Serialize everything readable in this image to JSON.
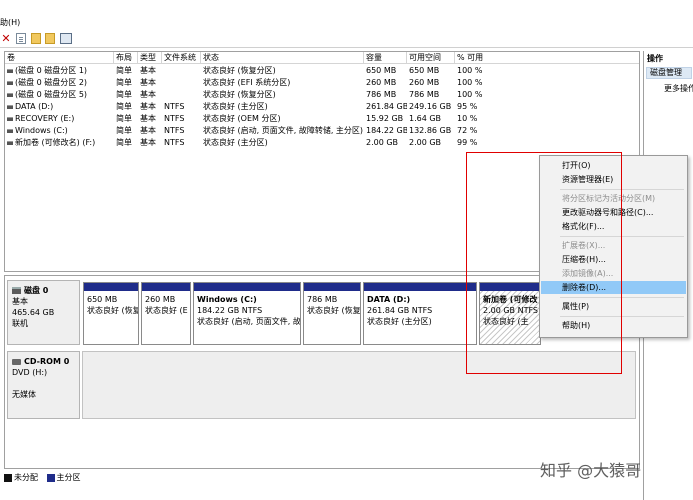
{
  "menu": {
    "help_label": "助(H)"
  },
  "toolbar": {
    "icons": [
      "delete-icon",
      "properties-icon",
      "folder-icon",
      "folder-icon",
      "panel-icon"
    ]
  },
  "volume_list": {
    "headers": [
      "卷",
      "布局",
      "类型",
      "文件系统",
      "状态",
      "容量",
      "可用空间",
      "% 可用"
    ],
    "rows": [
      [
        "(磁盘 0 磁盘分区 1)",
        "简单",
        "基本",
        "",
        "状态良好 (恢复分区)",
        "650 MB",
        "650 MB",
        "100 %"
      ],
      [
        "(磁盘 0 磁盘分区 2)",
        "简单",
        "基本",
        "",
        "状态良好 (EFI 系统分区)",
        "260 MB",
        "260 MB",
        "100 %"
      ],
      [
        "(磁盘 0 磁盘分区 5)",
        "简单",
        "基本",
        "",
        "状态良好 (恢复分区)",
        "786 MB",
        "786 MB",
        "100 %"
      ],
      [
        "DATA (D:)",
        "简单",
        "基本",
        "NTFS",
        "状态良好 (主分区)",
        "261.84 GB",
        "249.16 GB",
        "95 %"
      ],
      [
        "RECOVERY (E:)",
        "简单",
        "基本",
        "NTFS",
        "状态良好 (OEM 分区)",
        "15.92 GB",
        "1.64 GB",
        "10 %"
      ],
      [
        "Windows (C:)",
        "简单",
        "基本",
        "NTFS",
        "状态良好 (启动, 页面文件, 故障转储, 主分区)",
        "184.22 GB",
        "132.86 GB",
        "72 %"
      ],
      [
        "新加卷 (可修改名)  (F:)",
        "简单",
        "基本",
        "NTFS",
        "状态良好 (主分区)",
        "2.00 GB",
        "2.00 GB",
        "99 %"
      ]
    ]
  },
  "disk0": {
    "name": "磁盘 0",
    "type": "基本",
    "size": "465.64 GB",
    "status": "联机",
    "partitions": [
      {
        "name": "",
        "size": "650 MB",
        "status": "状态良好 (恢复"
      },
      {
        "name": "",
        "size": "260 MB",
        "status": "状态良好 (E"
      },
      {
        "name": "Windows  (C:)",
        "size": "184.22 GB NTFS",
        "status": "状态良好 (启动, 页面文件, 故"
      },
      {
        "name": "",
        "size": "786 MB",
        "status": "状态良好 (恢复"
      },
      {
        "name": "DATA  (D:)",
        "size": "261.84 GB NTFS",
        "status": "状态良好 (主分区)"
      },
      {
        "name": "新加卷 (可修改",
        "size": "2.00 GB NTFS",
        "status": "状态良好 (主"
      }
    ]
  },
  "cdrom0": {
    "name": "CD-ROM 0",
    "type": "DVD (H:)",
    "status": "无媒体"
  },
  "legend": [
    {
      "label": "未分配",
      "color": "#111111"
    },
    {
      "label": "主分区",
      "color": "#1f2c8a"
    }
  ],
  "actions": {
    "title": "操作",
    "selected": "磁盘管理",
    "more": "更多操作"
  },
  "context_menu": [
    {
      "label": "打开(O)",
      "enabled": true
    },
    {
      "label": "资源管理器(E)",
      "enabled": true
    },
    {
      "label": "将分区标记为活动分区(M)",
      "enabled": false
    },
    {
      "label": "更改驱动器号和路径(C)...",
      "enabled": true
    },
    {
      "label": "格式化(F)...",
      "enabled": true
    },
    {
      "label": "扩展卷(X)...",
      "enabled": false
    },
    {
      "label": "压缩卷(H)...",
      "enabled": true
    },
    {
      "label": "添加镜像(A)...",
      "enabled": false
    },
    {
      "label": "删除卷(D)...",
      "enabled": true,
      "highlighted": true
    },
    {
      "label": "属性(P)",
      "enabled": true
    },
    {
      "label": "帮助(H)",
      "enabled": true
    }
  ],
  "colors": {
    "primary_partition": "#1f2c8a",
    "highlight": "#91c9f7",
    "annotation": "#e00000"
  },
  "watermark": "知乎 @大猿哥"
}
